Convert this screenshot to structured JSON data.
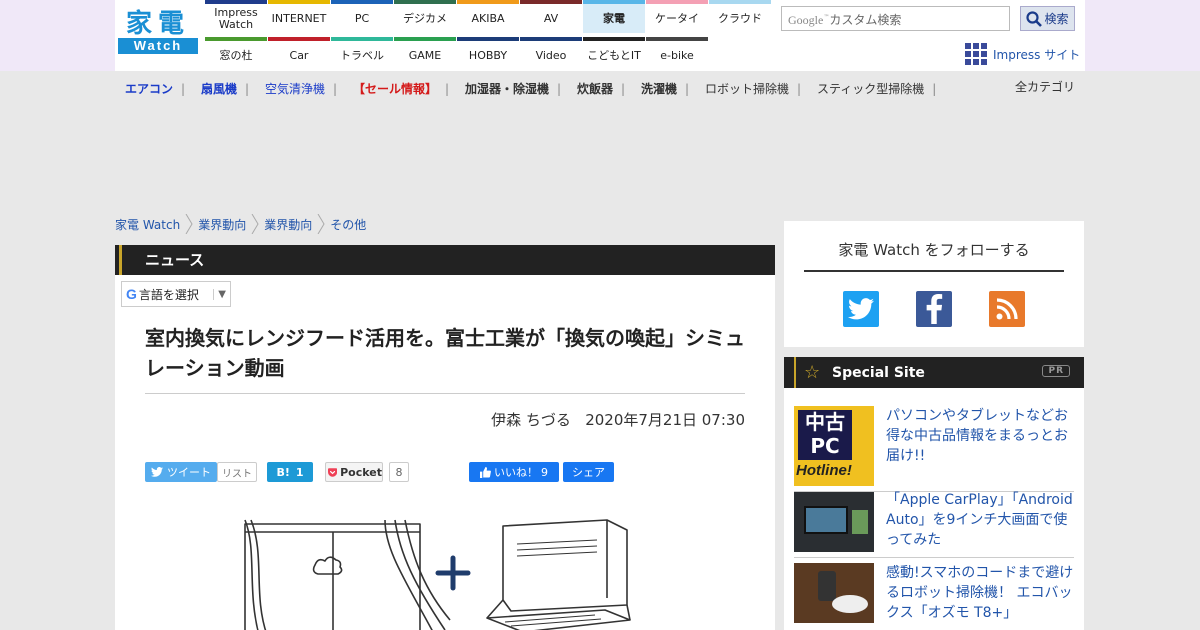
{
  "header": {
    "logo_top": "家電",
    "logo_bottom": "Watch",
    "nav_top": [
      {
        "label": "Impress Watch",
        "color": "#1f3c8c"
      },
      {
        "label": "INTERNET",
        "color": "#e6b800"
      },
      {
        "label": "PC",
        "color": "#1c63b8"
      },
      {
        "label": "デジカメ",
        "color": "#2f6f4f"
      },
      {
        "label": "AKIBA",
        "color": "#f09a1a"
      },
      {
        "label": "AV",
        "color": "#7a2a2a"
      },
      {
        "label": "家電",
        "color": "#58b6e8",
        "active": true
      },
      {
        "label": "ケータイ",
        "color": "#f4a0b4"
      },
      {
        "label": "クラウド",
        "color": "#a8d8f0"
      }
    ],
    "nav_bottom": [
      {
        "label": "窓の杜",
        "color": "#4a9a2e"
      },
      {
        "label": "Car",
        "color": "#c0202a"
      },
      {
        "label": "トラベル",
        "color": "#2fb89a"
      },
      {
        "label": "GAME",
        "color": "#2aa050"
      },
      {
        "label": "HOBBY",
        "color": "#1c3c78"
      },
      {
        "label": "Video",
        "color": "#1c3c78"
      },
      {
        "label": "こどもとIT",
        "color": "#222222"
      },
      {
        "label": "e-bike",
        "color": "#444444"
      }
    ],
    "search_google": "Google",
    "search_placeholder": "カスタム検索",
    "search_button": "検索",
    "impress_site": "Impress サイト"
  },
  "categories": [
    {
      "label": "エアコン",
      "color": "#1a3bc8",
      "bold": true
    },
    {
      "label": "扇風機",
      "color": "#1a3bc8",
      "bold": true
    },
    {
      "label": "空気清浄機",
      "color": "#1a3bc8",
      "bold": false
    },
    {
      "label": "【セール情報】",
      "color": "#d41a1a",
      "bold": true
    },
    {
      "label": "加湿器・除湿機",
      "color": "#333333",
      "bold": true
    },
    {
      "label": "炊飯器",
      "color": "#333333",
      "bold": true
    },
    {
      "label": "洗濯機",
      "color": "#333333",
      "bold": true
    },
    {
      "label": "ロボット掃除機",
      "color": "#333333",
      "bold": false
    },
    {
      "label": "スティック型掃除機",
      "color": "#333333",
      "bold": false
    }
  ],
  "all_categories": "全カテゴリ",
  "breadcrumb": [
    "家電 Watch",
    "業界動向",
    "業界動向",
    "その他"
  ],
  "article": {
    "section": "ニュース",
    "lang_select": "言語を選択",
    "title": "室内換気にレンジフード活用を。富士工業が「換気の喚起」シミュレーション動画",
    "author": "伊森 ちづる",
    "date": "2020年7月21日 07:30"
  },
  "social": {
    "tweet": "ツイート",
    "list": "リスト",
    "hatena": "B!",
    "hatena_count": "1",
    "pocket": "Pocket",
    "pocket_count": "8",
    "like": "いいね！",
    "like_count": "9",
    "share": "シェア"
  },
  "sidebar": {
    "follow_title": "家電 Watch をフォローする",
    "special_title": "Special Site",
    "pr": "PR",
    "hotline_thumb": {
      "line1": "中古",
      "line2": "PC",
      "line3": "Hotline!"
    },
    "items": [
      {
        "text": "パソコンやタブレットなどお得な中古品情報をまるっとお届け!!"
      },
      {
        "text": "「Apple CarPlay」「Android Auto」を9インチ大画面で使ってみた"
      },
      {
        "text": "感動!スマホのコードまで避けるロボット掃除機！ エコバックス「オズモ T8+」"
      }
    ]
  }
}
